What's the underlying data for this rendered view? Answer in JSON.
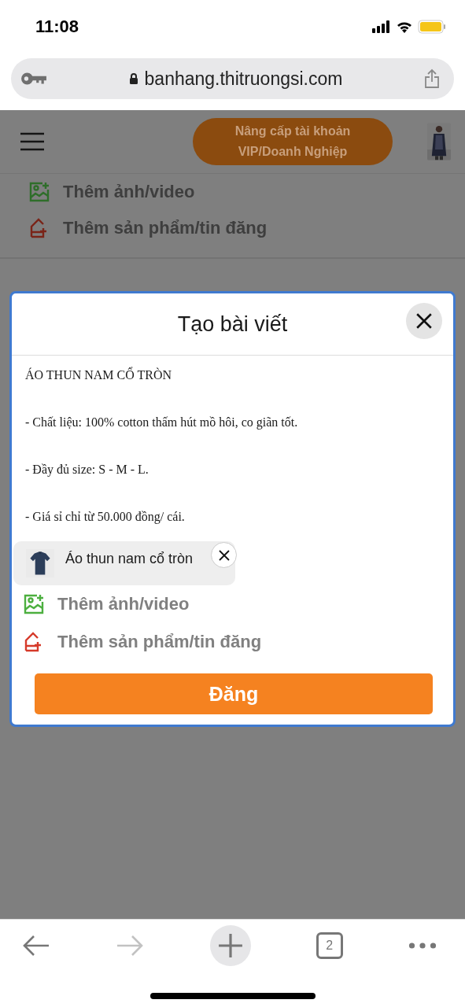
{
  "status_bar": {
    "time": "11:08"
  },
  "address_bar": {
    "url": "banhang.thitruongsi.com"
  },
  "page": {
    "upgrade_button": "Nâng cấp tài khoản VIP/Doanh Nghiệp",
    "actions": [
      {
        "kind": "media",
        "label": "Thêm ảnh/video"
      },
      {
        "kind": "product",
        "label": "Thêm sản phẩm/tin đăng"
      }
    ]
  },
  "dialog": {
    "title": "Tạo bài viết",
    "post_lines": [
      "ÁO THUN NAM CỔ TRÒN",
      "- Chất liệu: 100% cotton thấm hút mồ hôi, co giãn tốt.",
      "- Đầy đủ size: S - M - L.",
      "- Giá sỉ chỉ từ 50.000 đồng/ cái."
    ],
    "attached_product": {
      "name": "Áo thun nam cổ tròn"
    },
    "actions": [
      {
        "kind": "media",
        "label": "Thêm ảnh/video"
      },
      {
        "kind": "product",
        "label": "Thêm sản phẩm/tin đăng"
      }
    ],
    "submit_button": "Đăng"
  },
  "toolbar": [
    {
      "kind": "back",
      "disabled": false
    },
    {
      "kind": "forward",
      "disabled": true
    },
    {
      "kind": "new_tab",
      "disabled": false
    },
    {
      "kind": "tabs",
      "label": "2",
      "disabled": false
    },
    {
      "kind": "more",
      "disabled": false
    }
  ]
}
